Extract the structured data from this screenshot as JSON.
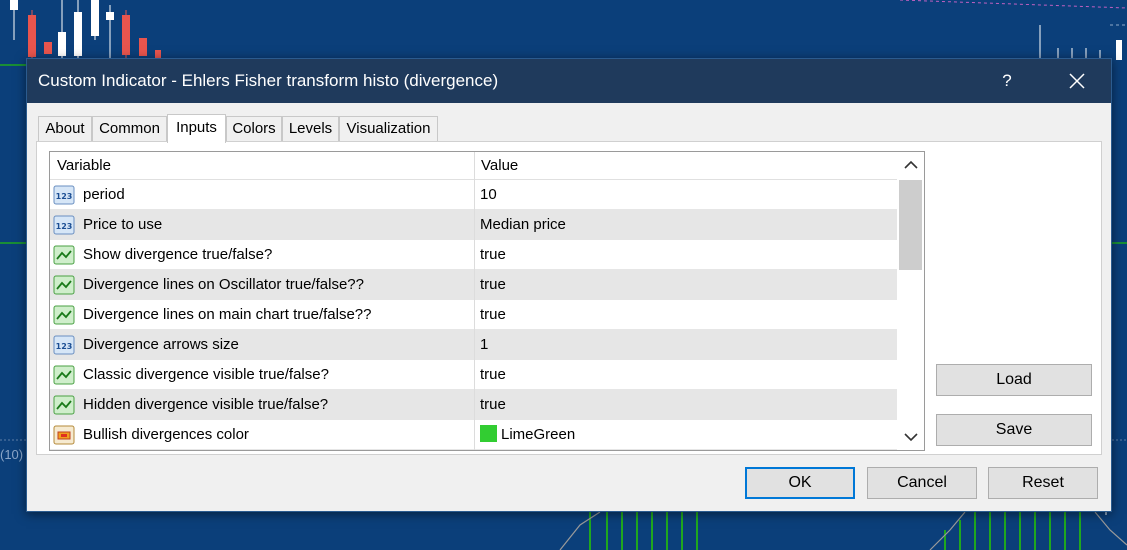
{
  "window": {
    "title": "Custom Indicator - Ehlers Fisher transform histo (divergence)",
    "help_label": "?",
    "close_icon": "close-icon"
  },
  "background": {
    "label": "(10)"
  },
  "tabs": [
    {
      "label": "About"
    },
    {
      "label": "Common"
    },
    {
      "label": "Inputs",
      "active": true
    },
    {
      "label": "Colors"
    },
    {
      "label": "Levels"
    },
    {
      "label": "Visualization"
    }
  ],
  "grid": {
    "columns": {
      "variable": "Variable",
      "value": "Value"
    },
    "rows": [
      {
        "icon": "numeric-icon",
        "variable": "period",
        "value": "10"
      },
      {
        "icon": "numeric-icon",
        "variable": "Price to use",
        "value": "Median price"
      },
      {
        "icon": "boolean-icon",
        "variable": "Show divergence true/false?",
        "value": "true"
      },
      {
        "icon": "boolean-icon",
        "variable": "Divergence lines on Oscillator true/false??",
        "value": "true"
      },
      {
        "icon": "boolean-icon",
        "variable": "Divergence lines on main chart true/false??",
        "value": "true"
      },
      {
        "icon": "numeric-icon",
        "variable": "Divergence arrows size",
        "value": "1"
      },
      {
        "icon": "boolean-icon",
        "variable": "Classic divergence visible true/false?",
        "value": "true"
      },
      {
        "icon": "boolean-icon",
        "variable": "Hidden divergence visible true/false?",
        "value": "true"
      },
      {
        "icon": "color-icon",
        "variable": "Bullish divergences color",
        "value": "LimeGreen",
        "swatch": "#32cd32"
      }
    ]
  },
  "buttons": {
    "load": "Load",
    "save": "Save",
    "ok": "OK",
    "cancel": "Cancel",
    "reset": "Reset"
  },
  "colors": {
    "chart_background": "#0b3f7a",
    "titlebar": "#1f3a5c",
    "accent": "#0078d7",
    "bear_candle": "#e8554e",
    "bull_candle": "#ffffff",
    "histogram": "#1fa81f"
  }
}
